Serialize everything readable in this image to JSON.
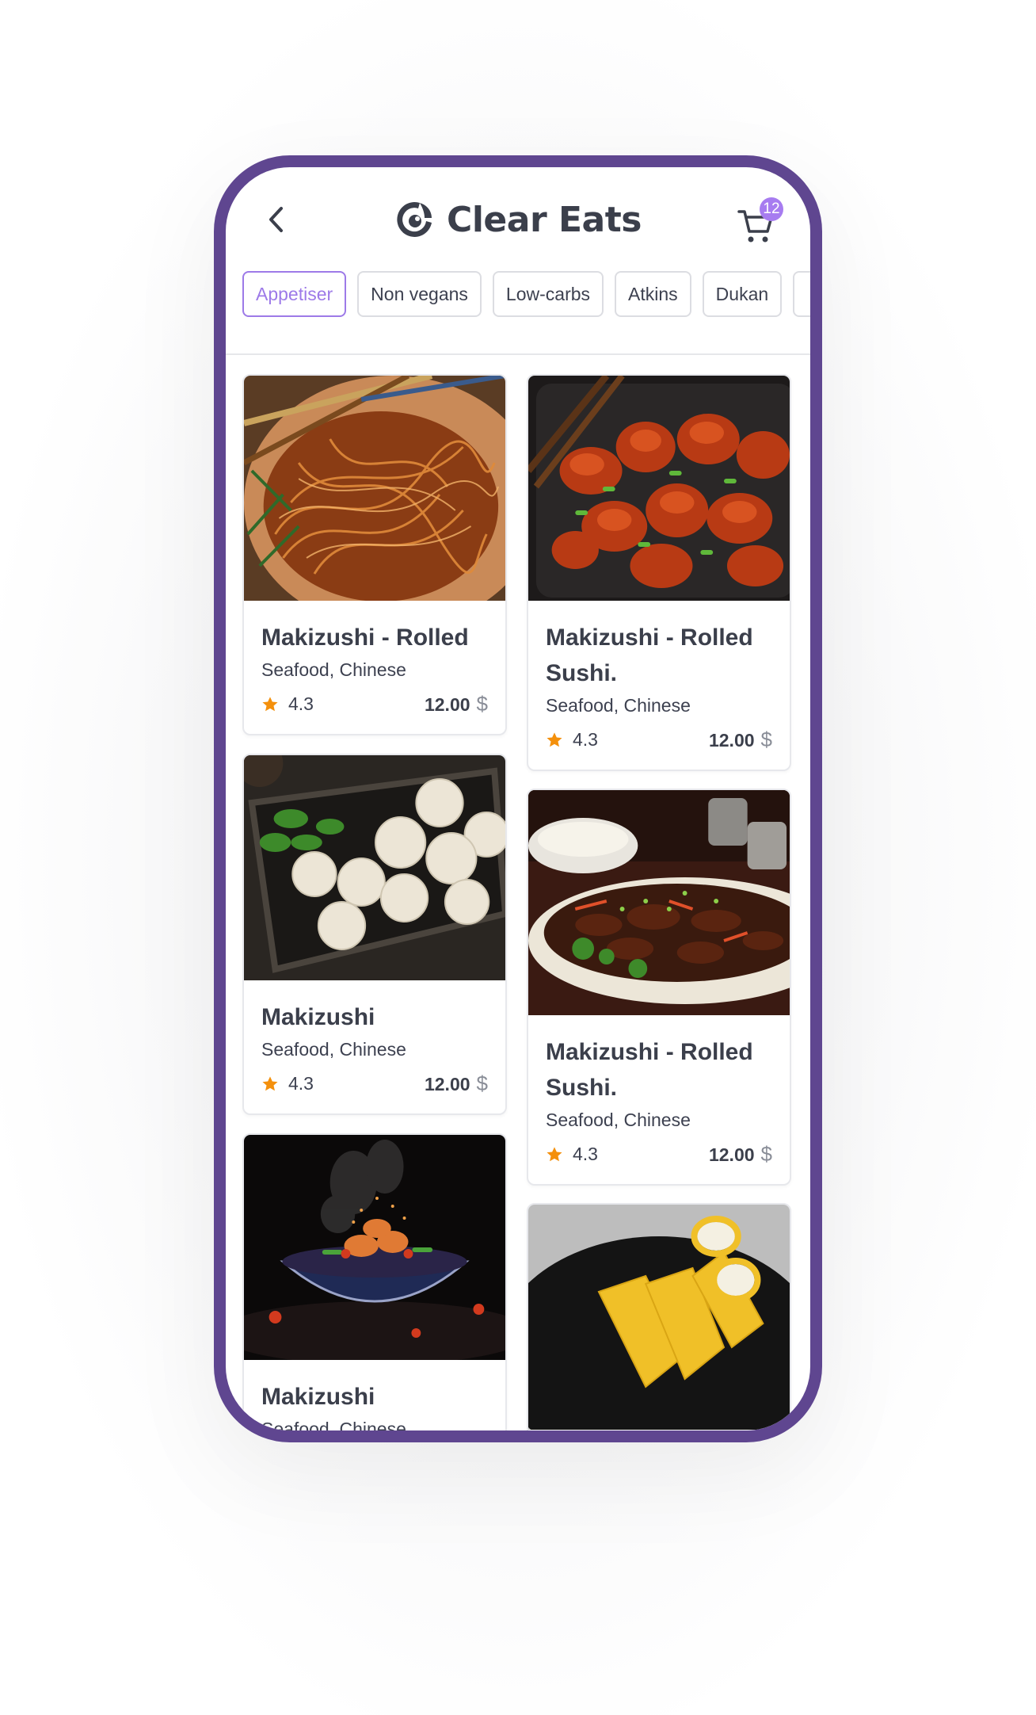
{
  "header": {
    "title": "Clear Eats",
    "cart_count": "12"
  },
  "tabs": [
    {
      "label": "Appetiser",
      "active": true
    },
    {
      "label": "Non vegans",
      "active": false
    },
    {
      "label": "Low-carbs",
      "active": false
    },
    {
      "label": "Atkins",
      "active": false
    },
    {
      "label": "Dukan",
      "active": false
    }
  ],
  "cards": [
    {
      "title": "Makizushi - Rolled",
      "subtitle": "Seafood, Chinese",
      "rating": "4.3",
      "price": "12.00",
      "currency": "$",
      "image": "noodles-image"
    },
    {
      "title": "Makizushi - Rolled Sushi.",
      "subtitle": "Seafood, Chinese",
      "rating": "4.3",
      "price": "12.00",
      "currency": "$",
      "image": "chicken-image"
    },
    {
      "title": "Makizushi",
      "subtitle": "Seafood, Chinese",
      "rating": "4.3",
      "price": "12.00",
      "currency": "$",
      "image": "dumplings-image"
    },
    {
      "title": "Makizushi - Rolled Sushi.",
      "subtitle": "Seafood, Chinese",
      "rating": "4.3",
      "price": "12.00",
      "currency": "$",
      "image": "beef-image"
    },
    {
      "title": "Makizushi",
      "subtitle": "Seafood, Chinese",
      "rating": "",
      "price": "",
      "currency": "",
      "image": "wok-bowl-image"
    },
    {
      "title": "",
      "subtitle": "",
      "rating": "",
      "price": "",
      "currency": "",
      "image": "crepe-rolls-image"
    }
  ],
  "colors": {
    "frame": "#5f4690",
    "accent": "#9d7ae8",
    "badge": "#a77cf0",
    "star": "#f4900c",
    "text": "#3b3f4b"
  }
}
